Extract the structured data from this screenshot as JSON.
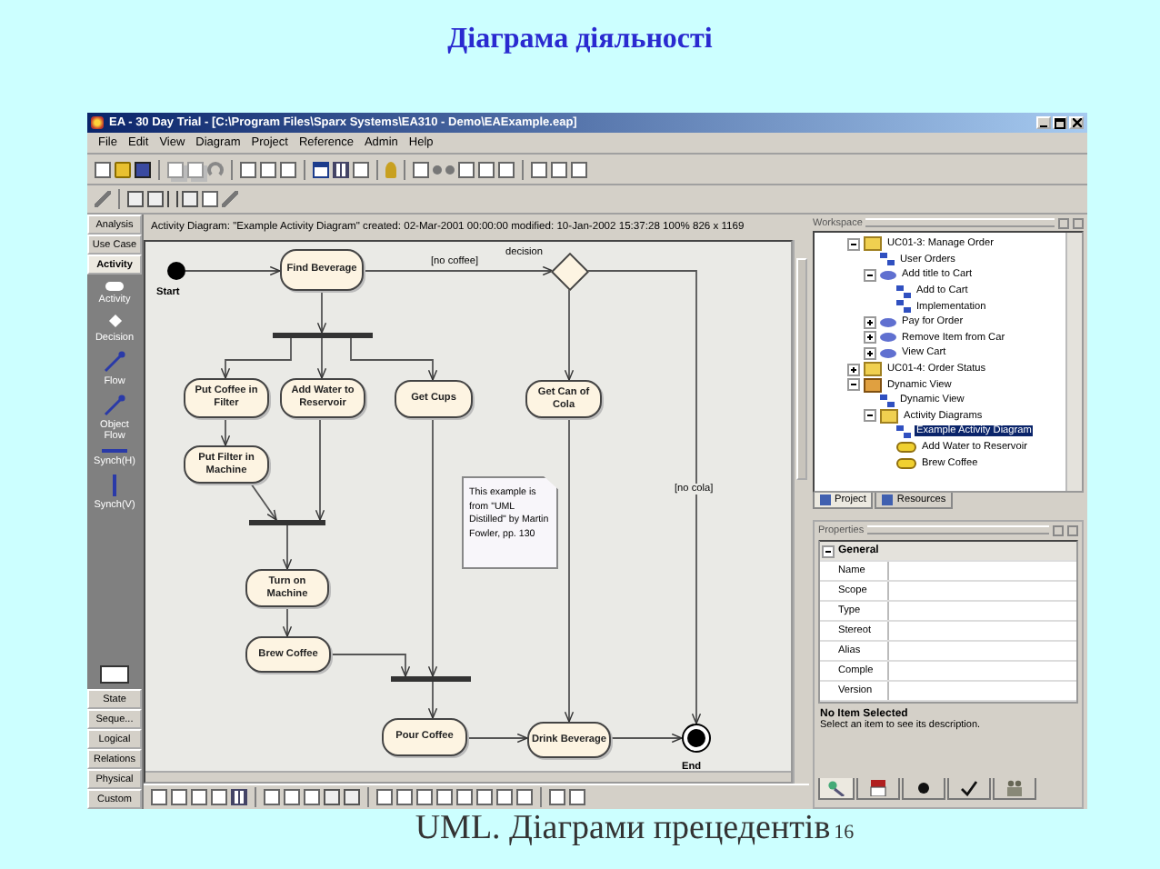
{
  "slide_title": "Діаграма діяльності",
  "window": {
    "title": "EA - 30 Day Trial - [C:\\Program Files\\Sparx Systems\\EA310 - Demo\\EAExample.eap]"
  },
  "menu": [
    "File",
    "Edit",
    "View",
    "Diagram",
    "Project",
    "Reference",
    "Admin",
    "Help"
  ],
  "toolbox": {
    "top_tabs": [
      {
        "label": "Analysis",
        "selected": false
      },
      {
        "label": "Use Case",
        "selected": false
      },
      {
        "label": "Activity",
        "selected": true
      }
    ],
    "tools": [
      {
        "kind": "activity",
        "label": "Activity"
      },
      {
        "kind": "decision",
        "label": "Decision"
      },
      {
        "kind": "flow",
        "label": "Flow"
      },
      {
        "kind": "object_flow",
        "label": "Object Flow"
      },
      {
        "kind": "synch_h",
        "label": "Synch(H)"
      },
      {
        "kind": "synch_v",
        "label": "Synch(V)"
      }
    ],
    "bottom_tabs": [
      {
        "label": "State",
        "selected": false
      },
      {
        "label": "Seque...",
        "selected": false
      },
      {
        "label": "Logical",
        "selected": false
      },
      {
        "label": "Relations",
        "selected": false
      },
      {
        "label": "Physical",
        "selected": false
      },
      {
        "label": "Custom",
        "selected": false
      }
    ]
  },
  "diagram": {
    "header": "Activity Diagram:  \"Example Activity Diagram\"   created: 02-Mar-2001 00:00:00  modified: 10-Jan-2002 15:37:28   100%   826 x 1169",
    "nodes": [
      {
        "kind": "initial",
        "label": "Start"
      },
      {
        "kind": "activity",
        "label": "Find Beverage"
      },
      {
        "kind": "decision",
        "label": "decision"
      },
      {
        "kind": "fork"
      },
      {
        "kind": "activity",
        "label": "Put Coffee in Filter"
      },
      {
        "kind": "activity",
        "label": "Add Water to Reservoir"
      },
      {
        "kind": "activity",
        "label": "Get Cups"
      },
      {
        "kind": "activity",
        "label": "Get Can of Cola"
      },
      {
        "kind": "activity",
        "label": "Put Filter in Machine"
      },
      {
        "kind": "fork"
      },
      {
        "kind": "activity",
        "label": "Turn on Machine"
      },
      {
        "kind": "activity",
        "label": "Brew Coffee"
      },
      {
        "kind": "fork"
      },
      {
        "kind": "activity",
        "label": "Pour Coffee"
      },
      {
        "kind": "activity",
        "label": "Drink Beverage"
      },
      {
        "kind": "final",
        "label": "End"
      }
    ],
    "guards": [
      "[no coffee]",
      "[no cola]"
    ],
    "note": "This example is from \"UML Distilled\" by Martin Fowler,  pp. 130"
  },
  "workspace": {
    "title": "Workspace",
    "tree": [
      {
        "kind": "folder",
        "label": "UC01-3: Manage Order",
        "expanded": true,
        "selected": false,
        "children": [
          {
            "kind": "diagram",
            "label": "User Orders",
            "selected": false
          },
          {
            "kind": "usecase",
            "label": "Add title to Cart",
            "expanded": true,
            "selected": false,
            "children": [
              {
                "kind": "diagram",
                "label": "Add to Cart",
                "selected": false
              },
              {
                "kind": "diagram",
                "label": "Implementation",
                "selected": false
              }
            ]
          },
          {
            "kind": "usecase",
            "label": "Pay for Order",
            "expanded": false,
            "selected": false
          },
          {
            "kind": "usecase",
            "label": "Remove Item from Car",
            "expanded": false,
            "selected": false
          },
          {
            "kind": "usecase",
            "label": "View Cart",
            "expanded": false,
            "selected": false
          }
        ]
      },
      {
        "kind": "folder",
        "label": "UC01-4: Order Status",
        "expanded": false,
        "selected": false
      },
      {
        "kind": "package",
        "label": "Dynamic View",
        "expanded": true,
        "selected": false,
        "children": [
          {
            "kind": "diagram",
            "label": "Dynamic View",
            "selected": false
          },
          {
            "kind": "folder",
            "label": "Activity Diagrams",
            "expanded": true,
            "selected": false,
            "children": [
              {
                "kind": "diagram",
                "label": "Example Activity Diagram",
                "selected": true
              },
              {
                "kind": "activity",
                "label": "Add Water to Reservoir",
                "selected": false
              },
              {
                "kind": "activity",
                "label": "Brew Coffee",
                "selected": false
              }
            ]
          }
        ]
      }
    ],
    "tabs": [
      {
        "label": "Project",
        "selected": true
      },
      {
        "label": "Resources",
        "selected": false
      }
    ]
  },
  "properties": {
    "title": "Properties",
    "group": "General",
    "group_expanded": true,
    "rows": [
      "Name",
      "Scope",
      "Type",
      "Stereot",
      "Alias",
      "Comple",
      "Version"
    ],
    "description_title": "No Item Selected",
    "description": "Select an item to see its description.",
    "tabs": [
      {
        "kind": "tools",
        "selected": true
      },
      {
        "kind": "book",
        "selected": false
      },
      {
        "kind": "dot",
        "selected": false
      },
      {
        "kind": "check",
        "selected": false
      },
      {
        "kind": "people",
        "selected": false
      }
    ]
  },
  "footer": "UML. Діаграми прецедентів",
  "slide_number": "16"
}
